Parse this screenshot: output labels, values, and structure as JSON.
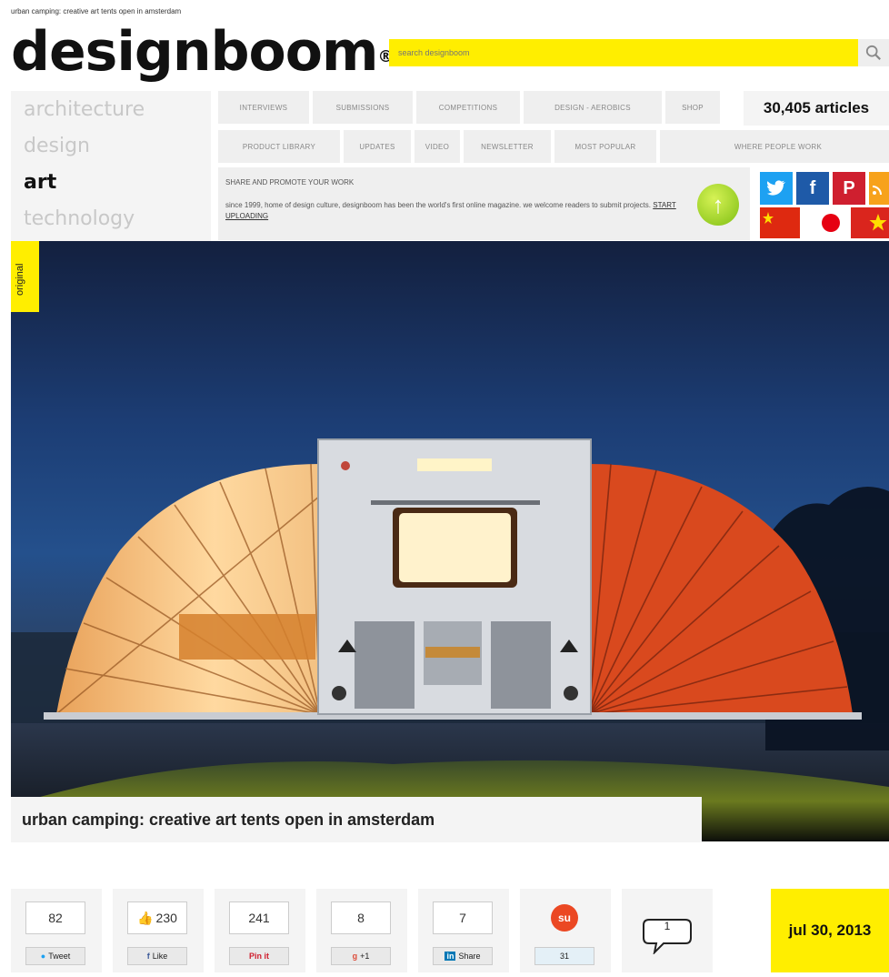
{
  "page": {
    "breadcrumb": "urban camping: creative art tents open in amsterdam"
  },
  "header": {
    "logo": "designboom",
    "logo_mark": "®",
    "search_placeholder": "search designboom",
    "search_icon": "search-icon"
  },
  "categories": [
    {
      "label": "architecture",
      "active": false
    },
    {
      "label": "design",
      "active": false
    },
    {
      "label": "art",
      "active": true
    },
    {
      "label": "technology",
      "active": false
    }
  ],
  "nav_row1": [
    "INTERVIEWS",
    "SUBMISSIONS",
    "COMPETITIONS",
    "DESIGN - AEROBICS",
    "SHOP"
  ],
  "nav_row2": [
    "PRODUCT LIBRARY",
    "UPDATES",
    "VIDEO",
    "NEWSLETTER",
    "MOST POPULAR",
    "WHERE PEOPLE WORK"
  ],
  "articles_count": "30,405 articles",
  "promo": {
    "title": "SHARE AND PROMOTE YOUR WORK",
    "text": "since 1999, home of design culture, designboom has been the world's first online magazine. we welcome readers to submit projects.",
    "link": "START UPLOADING"
  },
  "social_icons": [
    "twitter-icon",
    "facebook-icon",
    "pinterest-icon",
    "rss-icon"
  ],
  "flags": [
    "china-flag",
    "japan-flag",
    "vietnam-flag"
  ],
  "article": {
    "tag": "original",
    "title": "urban camping: creative art tents open in amsterdam",
    "date": "jul 30, 2013"
  },
  "share": [
    {
      "count": "82",
      "label": "Tweet"
    },
    {
      "count": "230",
      "label": "Like"
    },
    {
      "count": "241",
      "label": "Pin it"
    },
    {
      "count": "8",
      "label": "+1"
    },
    {
      "count": "7",
      "label": "Share"
    },
    {
      "count": "",
      "label": "31"
    },
    {
      "count": "1",
      "label": ""
    }
  ],
  "colors": {
    "accent": "#ffee00",
    "twitter": "#1da1f2",
    "facebook": "#1e5aa8",
    "pinterest": "#cf1f2f",
    "rss": "#f7a21b"
  }
}
